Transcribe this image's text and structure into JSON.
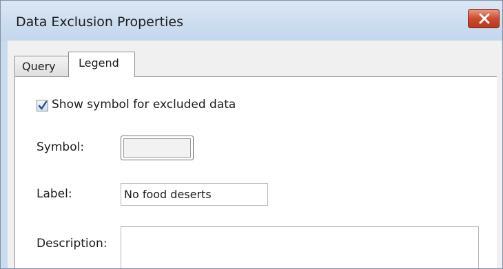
{
  "window": {
    "title": "Data Exclusion Properties",
    "close_icon": "close-icon"
  },
  "tabs": [
    {
      "label": "Query",
      "selected": false
    },
    {
      "label": "Legend",
      "selected": true
    }
  ],
  "legend": {
    "show_symbol": {
      "label": "Show symbol for excluded data",
      "checked": true
    },
    "symbol": {
      "label": "Symbol:"
    },
    "label_field": {
      "label": "Label:",
      "value": "No food deserts"
    },
    "description": {
      "label": "Description:",
      "value": ""
    }
  },
  "colors": {
    "title_bar": "#c9dbee",
    "close_button": "#cf4b2e",
    "checkbox_check": "#2b4f8f"
  }
}
